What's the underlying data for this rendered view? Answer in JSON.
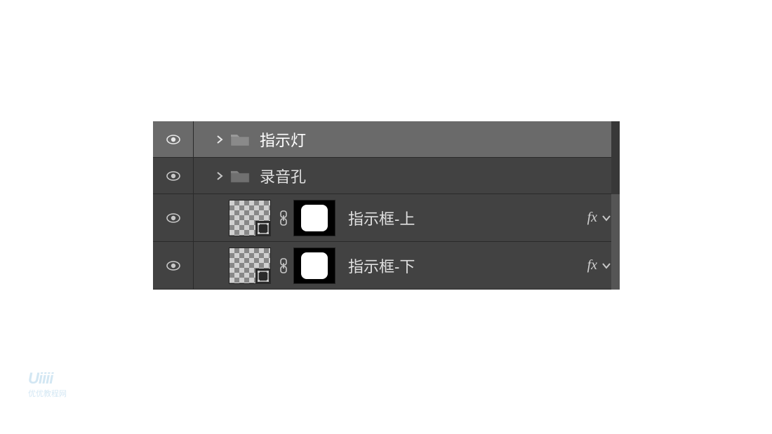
{
  "layers": [
    {
      "id": "group1",
      "name": "指示灯",
      "type": "group",
      "selected": true
    },
    {
      "id": "group2",
      "name": "录音孔",
      "type": "group",
      "selected": false
    },
    {
      "id": "layer1",
      "name": "指示框-上",
      "type": "smart",
      "fx": "fx"
    },
    {
      "id": "layer2",
      "name": "指示框-下",
      "type": "smart",
      "fx": "fx"
    }
  ],
  "watermark": {
    "logo": "Uiiii",
    "sub": "优优教程网"
  }
}
